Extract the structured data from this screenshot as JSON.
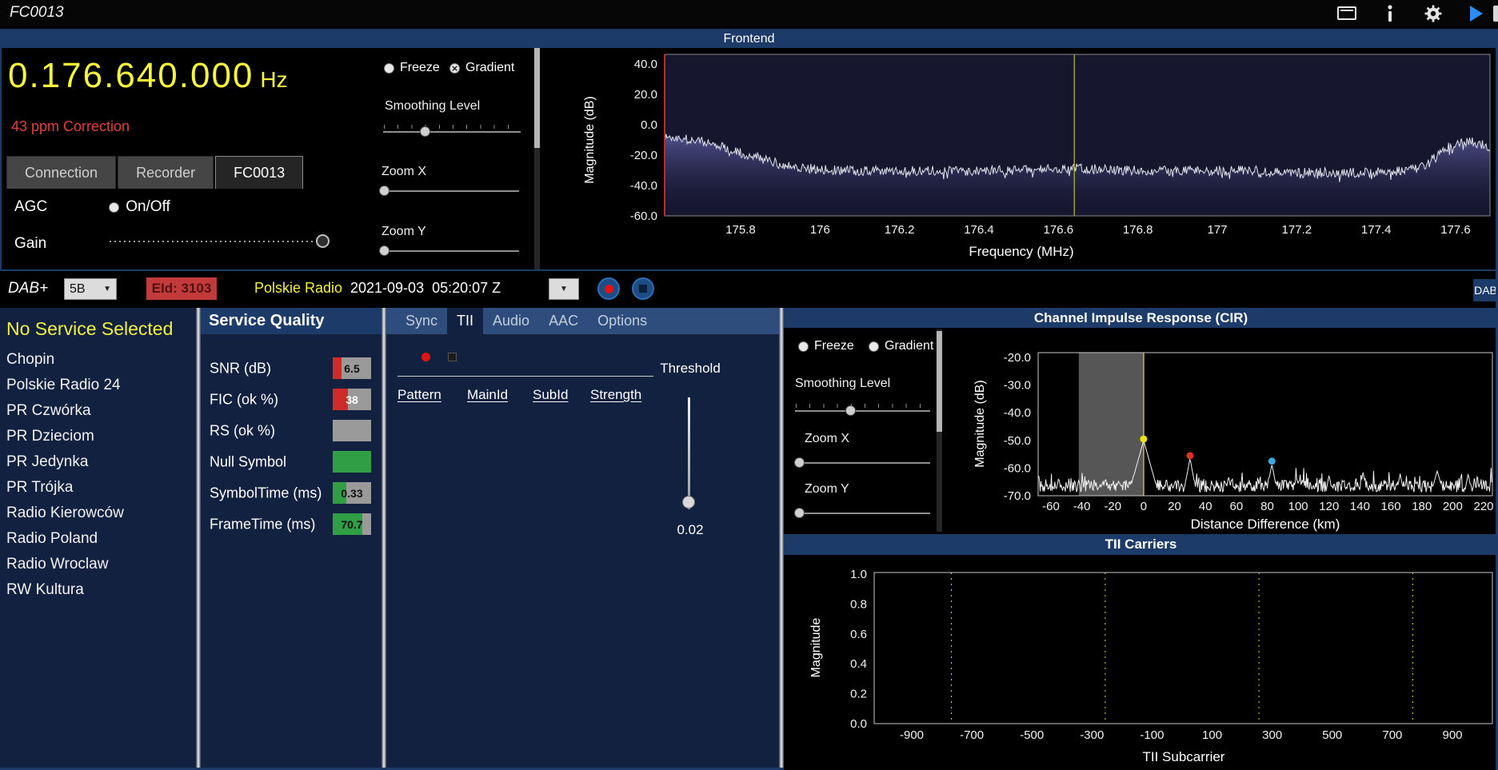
{
  "window": {
    "title": "FC0013"
  },
  "frontend": {
    "title": "Frontend",
    "frequency": "0.176.640.000",
    "frequency_unit": "Hz",
    "correction": "43 ppm Correction",
    "tabs": [
      {
        "label": "Connection",
        "active": false
      },
      {
        "label": "Recorder",
        "active": false
      },
      {
        "label": "FC0013",
        "active": true
      }
    ],
    "agc_label": "AGC",
    "agc_option": "On/Off",
    "gain_label": "Gain",
    "freeze_label": "Freeze",
    "gradient_label": "Gradient",
    "smoothing_label": "Smoothing Level",
    "zoom_x_label": "Zoom X",
    "zoom_y_label": "Zoom Y"
  },
  "dab_bar": {
    "mode": "DAB+",
    "channel": "5B",
    "eid": "EId: 3103",
    "ensemble": "Polskie Radio",
    "timestamp": "2021-09-03  05:20:07 Z",
    "corner_label": "DAB"
  },
  "services": {
    "header": "No Service Selected",
    "items": [
      "Chopin",
      "Polskie Radio 24",
      "PR Czwórka",
      "PR Dzieciom",
      "PR Jedynka",
      "PR Trójka",
      "Radio Kierowców",
      "Radio Poland",
      "Radio Wroclaw",
      "RW Kultura"
    ]
  },
  "service_quality": {
    "title": "Service Quality",
    "rows": [
      {
        "label": "SNR (dB)",
        "value": "6.5",
        "fill_color": "#cf2b2b",
        "fill_pct": 22,
        "value_color": "#101010"
      },
      {
        "label": "FIC (ok %)",
        "value": "38",
        "fill_color": "#cf2b2b",
        "fill_pct": 40,
        "value_color": "#ffffff"
      },
      {
        "label": "RS (ok %)",
        "value": "",
        "fill_color": "#9a9a9a",
        "fill_pct": 0,
        "value_color": "#101010"
      },
      {
        "label": "Null Symbol",
        "value": "",
        "fill_color": "#2f9e44",
        "fill_pct": 100,
        "value_color": "#101010"
      },
      {
        "label": "SymbolTime (ms)",
        "value": "0.33",
        "fill_color": "#2f9e44",
        "fill_pct": 35,
        "value_color": "#101010"
      },
      {
        "label": "FrameTime (ms)",
        "value": "70.7",
        "fill_color": "#2f9e44",
        "fill_pct": 78,
        "value_color": "#101010"
      }
    ]
  },
  "detail_tabs": {
    "tabs": [
      {
        "label": "Sync",
        "active": false
      },
      {
        "label": "TII",
        "active": true
      },
      {
        "label": "Audio",
        "active": false
      },
      {
        "label": "AAC",
        "active": false
      },
      {
        "label": "Options",
        "active": false
      }
    ],
    "tii": {
      "columns": [
        "Pattern",
        "MainId",
        "SubId",
        "Strength"
      ],
      "threshold_label": "Threshold",
      "threshold_value": "0.02"
    }
  },
  "cir_panel": {
    "title": "Channel Impulse Response (CIR)",
    "freeze_label": "Freeze",
    "gradient_label": "Gradient",
    "smoothing_label": "Smoothing Level",
    "zoom_x_label": "Zoom X",
    "zoom_y_label": "Zoom Y"
  },
  "tii_carriers_panel": {
    "title": "TII Carriers"
  },
  "colors": {
    "header_blue": "#1d3b68",
    "panel_navy": "#132140",
    "frequency_yellow": "#f7f73e",
    "alert_red": "#e04040",
    "quality_red": "#cf2b2b",
    "quality_green": "#2f9e44"
  },
  "chart_data": [
    {
      "id": "frontend-spectrum",
      "type": "line",
      "title": "Frontend",
      "xlabel": "Frequency (MHz)",
      "ylabel": "Magnitude (dB)",
      "xlim": [
        175.61,
        177.686
      ],
      "ylim": [
        -60,
        40
      ],
      "xticks": [
        "175.8",
        "176",
        "176.2",
        "176.4",
        "176.6",
        "176.8",
        "177",
        "177.2",
        "177.4",
        "177.6"
      ],
      "yticks": [
        "40.0",
        "20.0",
        "0.0",
        "-20.0",
        "-40.0",
        "-60.0"
      ],
      "grid": false,
      "legend": false,
      "tuned_marker_x": 176.64,
      "noise_amplitude_db": 3.2,
      "envelope_points": [
        [
          175.61,
          -8
        ],
        [
          175.68,
          -10
        ],
        [
          175.75,
          -14
        ],
        [
          175.82,
          -20
        ],
        [
          175.9,
          -26
        ],
        [
          175.98,
          -29
        ],
        [
          176.1,
          -30.5
        ],
        [
          176.25,
          -30
        ],
        [
          176.4,
          -30.5
        ],
        [
          176.55,
          -29.5
        ],
        [
          176.64,
          -28.5
        ],
        [
          176.75,
          -30
        ],
        [
          176.9,
          -30.5
        ],
        [
          177.05,
          -30
        ],
        [
          177.2,
          -31
        ],
        [
          177.35,
          -31.5
        ],
        [
          177.45,
          -31
        ],
        [
          177.52,
          -27
        ],
        [
          177.57,
          -16
        ],
        [
          177.62,
          -11
        ],
        [
          177.66,
          -12
        ],
        [
          177.686,
          -15
        ]
      ]
    },
    {
      "id": "cir",
      "type": "line",
      "title": "Channel Impulse Response (CIR)",
      "xlabel": "Distance Difference (km)",
      "ylabel": "Magnitude (dB)",
      "xlim": [
        -68.3,
        225.7
      ],
      "ylim": [
        -72,
        -18.3
      ],
      "xticks": [
        "-60",
        "-40",
        "-20",
        "0",
        "20",
        "40",
        "60",
        "80",
        "100",
        "120",
        "140",
        "160",
        "180",
        "200",
        "220"
      ],
      "yticks": [
        "-20.0",
        "-30.0",
        "-40.0",
        "-50.0",
        "-60.0",
        "-70.0"
      ],
      "grid": false,
      "legend": false,
      "guard_region_km": [
        -42,
        0.5
      ],
      "tuned_marker_x": 0,
      "noise_floor_db": -66.5,
      "noise_amplitude_db": 2.2,
      "trace_peaks": [
        {
          "x": 0,
          "y": -50,
          "w": 3
        },
        {
          "x": 30,
          "y": -56.5,
          "w": 2
        },
        {
          "x": 55,
          "y": -63,
          "w": 2
        },
        {
          "x": 83,
          "y": -58.5,
          "w": 2
        },
        {
          "x": 120,
          "y": -62.5,
          "w": 2
        },
        {
          "x": 142,
          "y": -61.5,
          "w": 2
        },
        {
          "x": 166,
          "y": -62,
          "w": 2
        },
        {
          "x": 190,
          "y": -61,
          "w": 3
        },
        {
          "x": 210,
          "y": -62,
          "w": 2
        },
        {
          "x": -25,
          "y": -64,
          "w": 2
        },
        {
          "x": -55,
          "y": -63.5,
          "w": 2
        }
      ],
      "markers": [
        {
          "x": 0,
          "y": -49.5,
          "color": "#f0e000"
        },
        {
          "x": 30,
          "y": -55.5,
          "color": "#d93030"
        },
        {
          "x": 83,
          "y": -57.5,
          "color": "#3fa7e0"
        }
      ]
    },
    {
      "id": "tii-carriers",
      "type": "line",
      "title": "TII Carriers",
      "xlabel": "TII Subcarrier",
      "ylabel": "Magnitude",
      "xlim": [
        -1025,
        1033
      ],
      "ylim": [
        0,
        1
      ],
      "xticks": [
        "-900",
        "-700",
        "-500",
        "-300",
        "-100",
        "100",
        "300",
        "500",
        "700",
        "900"
      ],
      "yticks": [
        "1.0",
        "0.8",
        "0.6",
        "0.4",
        "0.2",
        "0.0"
      ],
      "grid": false,
      "legend": false,
      "carrier_block_lines_x": [
        -768,
        -256,
        256,
        768
      ],
      "series": []
    }
  ]
}
